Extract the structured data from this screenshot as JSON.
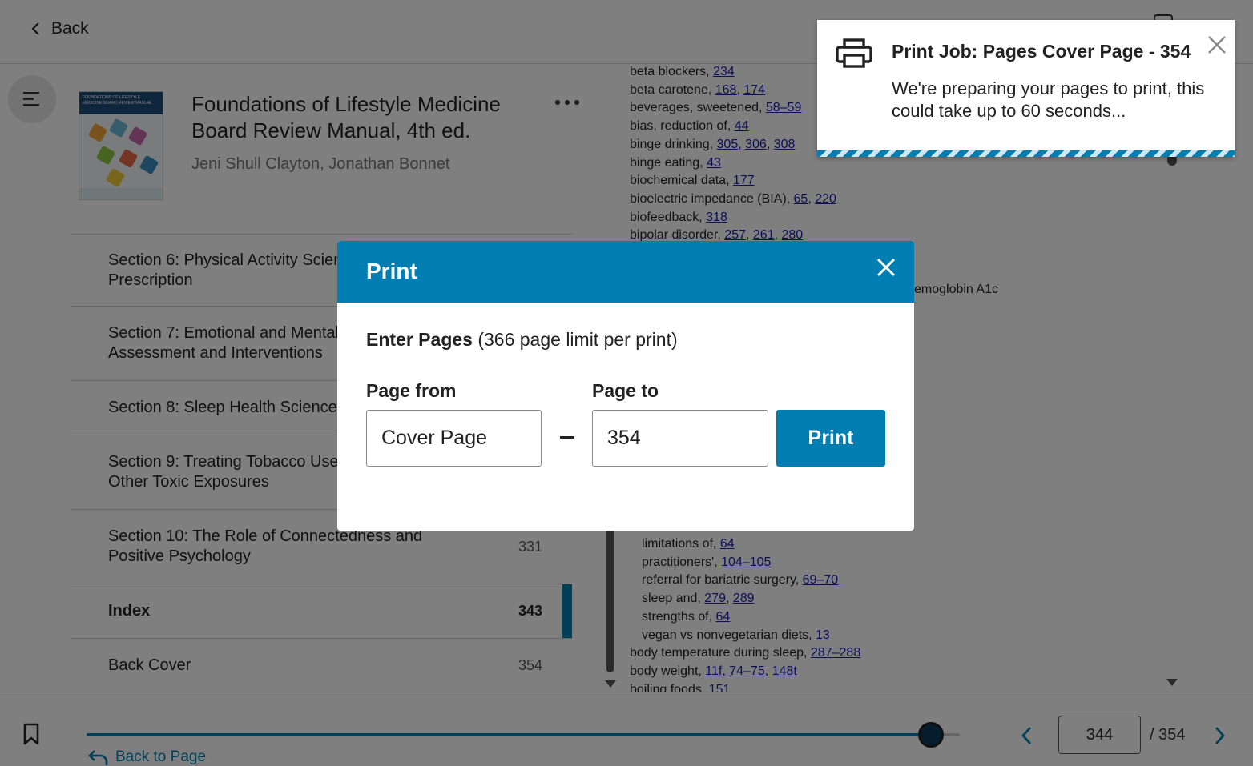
{
  "topbar": {
    "back_label": "Back"
  },
  "book": {
    "title": "Foundations of Lifestyle Medicine Board Review Manual, 4th ed.",
    "authors": "Jeni Shull Clayton, Jonathan Bonnet",
    "cover_title": "FOUNDATIONS OF LIFESTYLE MEDICINE BOARD REVIEW MANUAL"
  },
  "toc": {
    "items": [
      {
        "label": "Section 6: Physical Activity Science and Prescription",
        "page": ""
      },
      {
        "label": "Section 7: Emotional and Mental Health Assessment and Interventions",
        "page": ""
      },
      {
        "label": "Section 8: Sleep Health Science",
        "page": ""
      },
      {
        "label": "Section 9: Treating Tobacco Use and Managing Other Toxic Exposures",
        "page": ""
      },
      {
        "label": "Section 10: The Role of Connectedness and Positive Psychology",
        "page": "331"
      },
      {
        "label": "Index",
        "page": "343"
      },
      {
        "label": "Back Cover",
        "page": "354"
      }
    ]
  },
  "index_entries": [
    {
      "text": "beta blockers, ",
      "refs": [
        "234"
      ]
    },
    {
      "text": "beta carotene, ",
      "refs": [
        "168",
        "174"
      ]
    },
    {
      "text": "beverages, sweetened, ",
      "refs": [
        "58–59"
      ]
    },
    {
      "text": "bias, reduction of, ",
      "refs": [
        "44"
      ]
    },
    {
      "text": "binge drinking, ",
      "refs": [
        "305",
        "306",
        "308"
      ]
    },
    {
      "text": "binge eating, ",
      "refs": [
        "43"
      ]
    },
    {
      "text": "biochemical data, ",
      "refs": [
        "177"
      ]
    },
    {
      "text": "bioelectric impedance (BIA), ",
      "refs": [
        "65",
        "220"
      ]
    },
    {
      "text": "biofeedback, ",
      "refs": [
        "318"
      ]
    },
    {
      "text": "bipolar disorder, ",
      "refs": [
        "257",
        "261",
        "280"
      ]
    }
  ],
  "index_partial_right": "emoglobin A1c",
  "index_entries_lower": [
    {
      "text": "limitations of, ",
      "refs": [
        "64"
      ],
      "sub": true
    },
    {
      "text": "practitioners', ",
      "refs": [
        "104–105"
      ],
      "sub": true
    },
    {
      "text": "referral for bariatric surgery, ",
      "refs": [
        "69–70"
      ],
      "sub": true
    },
    {
      "text": "sleep and, ",
      "refs": [
        "279",
        "289"
      ],
      "sub": true
    },
    {
      "text": "strengths of, ",
      "refs": [
        "64"
      ],
      "sub": true
    },
    {
      "text": "vegan vs nonvegetarian diets, ",
      "refs": [
        "13"
      ],
      "sub": true
    },
    {
      "text": "body temperature during sleep, ",
      "refs": [
        "287–288"
      ],
      "sub": false
    },
    {
      "text": "body weight, ",
      "refs": [
        "11f",
        "74–75",
        "148t"
      ],
      "sub": false
    },
    {
      "text": "boiling foods, ",
      "refs": [
        "151"
      ],
      "sub": false
    }
  ],
  "bottombar": {
    "back_to_page_label": "Back to Page",
    "current_page": "344",
    "total_pages": "/ 354",
    "progress": 0.967
  },
  "toast": {
    "title": "Print Job: Pages Cover Page - 354",
    "message": "We're preparing your pages to print, this could take up to 60 seconds..."
  },
  "modal": {
    "title": "Print",
    "enter_pages_bold": "Enter Pages",
    "enter_pages_note": " (366 page limit per print)",
    "page_from_label": "Page from",
    "page_to_label": "Page to",
    "page_from_value": "Cover Page",
    "page_to_value": "354",
    "print_label": "Print"
  },
  "colors": {
    "accent": "#007eb1",
    "link": "#1a1ab0"
  }
}
